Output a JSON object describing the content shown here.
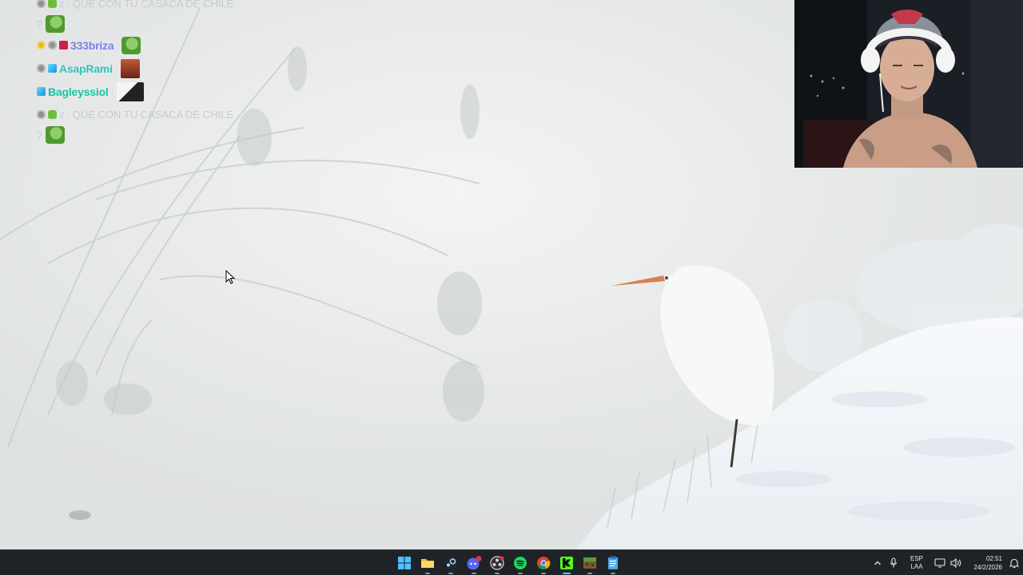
{
  "chat": {
    "partial_top": {
      "username": "z",
      "message": ": QUE CON TU CASACA DE CHILE"
    },
    "partial_cont": "?",
    "messages": [
      {
        "username": "333briza",
        "separator": ":",
        "emote": "pepe-emote"
      },
      {
        "username": "AsapRami",
        "separator": ":",
        "emote": "face-emote"
      },
      {
        "username": "Bagleyssiol",
        "separator": ":",
        "emote": "cat-emote"
      },
      {
        "username": "z",
        "separator": ":",
        "text": " QUE CON TU CASACA DE CHILE",
        "continuation": "?"
      }
    ]
  },
  "taskbar": {
    "apps": [
      {
        "name": "start-button",
        "icon": "windows-logo"
      },
      {
        "name": "file-explorer",
        "icon": "folder"
      },
      {
        "name": "steam",
        "icon": "steam"
      },
      {
        "name": "discord",
        "icon": "discord",
        "badge": "99+"
      },
      {
        "name": "obs",
        "icon": "obs"
      },
      {
        "name": "spotify",
        "icon": "spotify"
      },
      {
        "name": "chrome",
        "icon": "chrome"
      },
      {
        "name": "kick",
        "icon": "kick"
      },
      {
        "name": "minecraft",
        "icon": "minecraft"
      },
      {
        "name": "notepad",
        "icon": "notepad"
      }
    ],
    "tray": {
      "language_top": "ESP",
      "language_bottom": "LAA",
      "time": "02:51",
      "date": "24/2/2026"
    }
  },
  "colors": {
    "taskbar_bg": "#1f2327",
    "accent": "#5cc6ff"
  }
}
